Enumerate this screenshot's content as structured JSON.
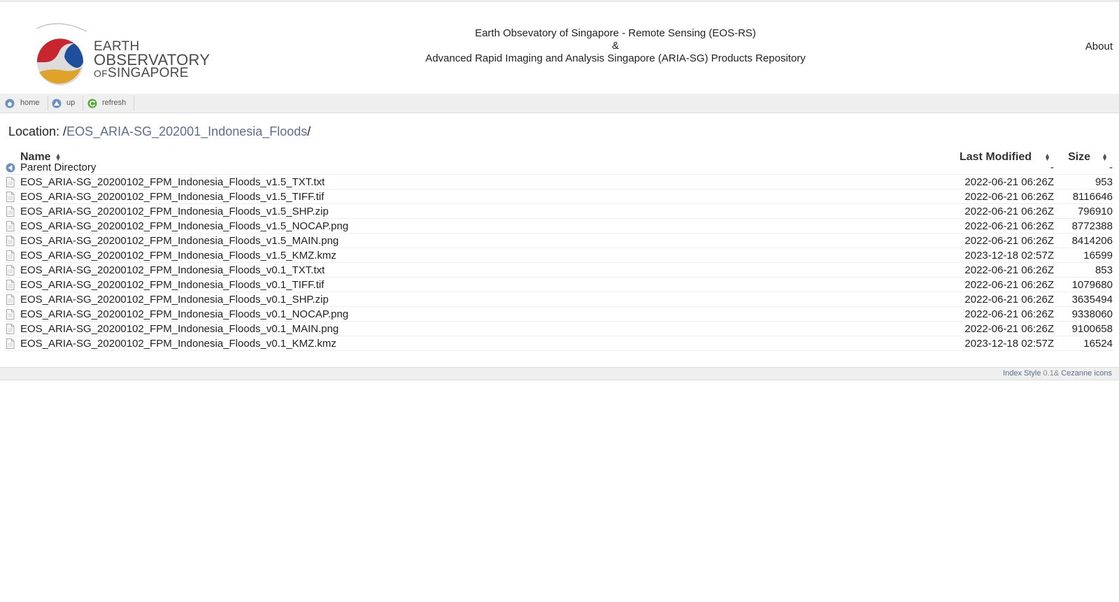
{
  "header": {
    "logo": {
      "line1": "EARTH",
      "line2": "OBSERVATORY",
      "line3_prefix": "OF",
      "line3": "SINGAPORE"
    },
    "title_line1": "Earth Obsevatory of Singapore - Remote Sensing (EOS-RS)",
    "title_line2": "&",
    "title_line3": "Advanced Rapid Imaging and Analysis Singapore (ARIA-SG) Products Repository",
    "about_label": "About"
  },
  "toolbar": {
    "home_label": "home",
    "up_label": "up",
    "refresh_label": "refresh"
  },
  "location": {
    "label": "Location: /",
    "crumb": "EOS_ARIA-SG_202001_Indonesia_Floods",
    "trail": "/"
  },
  "columns": {
    "name": "Name",
    "modified": "Last Modified",
    "size": "Size"
  },
  "parent": {
    "name": "Parent Directory",
    "modified": "-",
    "size": "-"
  },
  "files": [
    {
      "name": "EOS_ARIA-SG_20200102_FPM_Indonesia_Floods_v1.5_TXT.txt",
      "modified": "2022-06-21 06:26Z",
      "size": "953"
    },
    {
      "name": "EOS_ARIA-SG_20200102_FPM_Indonesia_Floods_v1.5_TIFF.tif",
      "modified": "2022-06-21 06:26Z",
      "size": "8116646"
    },
    {
      "name": "EOS_ARIA-SG_20200102_FPM_Indonesia_Floods_v1.5_SHP.zip",
      "modified": "2022-06-21 06:26Z",
      "size": "796910"
    },
    {
      "name": "EOS_ARIA-SG_20200102_FPM_Indonesia_Floods_v1.5_NOCAP.png",
      "modified": "2022-06-21 06:26Z",
      "size": "8772388"
    },
    {
      "name": "EOS_ARIA-SG_20200102_FPM_Indonesia_Floods_v1.5_MAIN.png",
      "modified": "2022-06-21 06:26Z",
      "size": "8414206"
    },
    {
      "name": "EOS_ARIA-SG_20200102_FPM_Indonesia_Floods_v1.5_KMZ.kmz",
      "modified": "2023-12-18 02:57Z",
      "size": "16599"
    },
    {
      "name": "EOS_ARIA-SG_20200102_FPM_Indonesia_Floods_v0.1_TXT.txt",
      "modified": "2022-06-21 06:26Z",
      "size": "853"
    },
    {
      "name": "EOS_ARIA-SG_20200102_FPM_Indonesia_Floods_v0.1_TIFF.tif",
      "modified": "2022-06-21 06:26Z",
      "size": "1079680"
    },
    {
      "name": "EOS_ARIA-SG_20200102_FPM_Indonesia_Floods_v0.1_SHP.zip",
      "modified": "2022-06-21 06:26Z",
      "size": "3635494"
    },
    {
      "name": "EOS_ARIA-SG_20200102_FPM_Indonesia_Floods_v0.1_NOCAP.png",
      "modified": "2022-06-21 06:26Z",
      "size": "9338060"
    },
    {
      "name": "EOS_ARIA-SG_20200102_FPM_Indonesia_Floods_v0.1_MAIN.png",
      "modified": "2022-06-21 06:26Z",
      "size": "9100658"
    },
    {
      "name": "EOS_ARIA-SG_20200102_FPM_Indonesia_Floods_v0.1_KMZ.kmz",
      "modified": "2023-12-18 02:57Z",
      "size": "16524"
    }
  ],
  "footer": {
    "index_style": "Index Style",
    "version": " 0.1&",
    "icons": " Cezanne icons"
  },
  "icons": {
    "home": "home-icon",
    "up": "up-arrow-icon",
    "refresh": "refresh-icon",
    "parent": "back-arrow-icon",
    "file": "file-icon"
  },
  "colors": {
    "link": "#5a6f8f",
    "toolbar_bg": "#efefef",
    "logo_red": "#c8262f",
    "logo_blue": "#1f4f9a",
    "logo_gold": "#e0a32a"
  }
}
